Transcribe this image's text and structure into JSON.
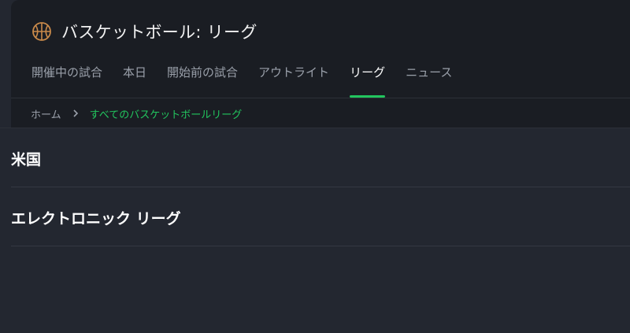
{
  "header": {
    "icon": "basketball-icon",
    "title": "バスケットボール: リーグ",
    "tabs": [
      {
        "label": "開催中の試合",
        "active": false
      },
      {
        "label": "本日",
        "active": false
      },
      {
        "label": "開始前の試合",
        "active": false
      },
      {
        "label": "アウトライト",
        "active": false
      },
      {
        "label": "リーグ",
        "active": true
      },
      {
        "label": "ニュース",
        "active": false
      }
    ]
  },
  "breadcrumb": {
    "home": "ホーム",
    "separator_icon": "chevron-right-icon",
    "current": "すべてのバスケットボールリーグ"
  },
  "leagues": [
    {
      "name": "米国"
    },
    {
      "name": "エレクトロニック リーグ"
    }
  ],
  "colors": {
    "accent": "#22c55e",
    "background": "#232730",
    "header_background": "#1a1d23",
    "icon": "#c98a4a"
  }
}
